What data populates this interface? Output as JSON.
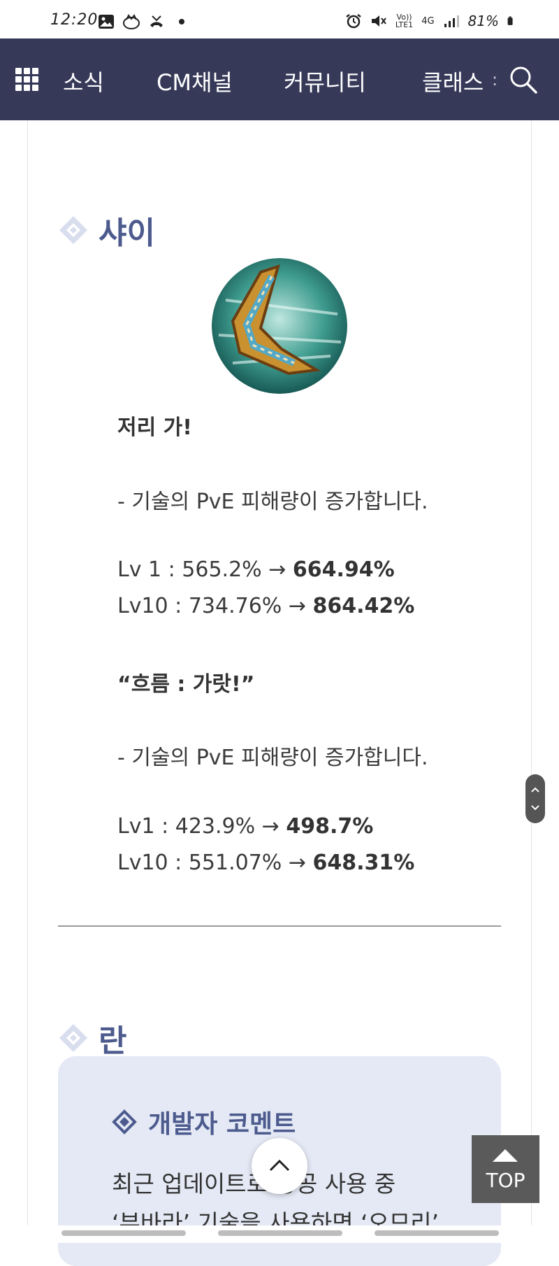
{
  "status_bar": {
    "time": "12:20",
    "battery": "81%",
    "network_top": "Vo))",
    "network_bottom": "LTE1",
    "signal_label": "4G"
  },
  "nav": {
    "items": [
      "소식",
      "CM채널",
      "커뮤니티",
      "클래스"
    ],
    "more": ":"
  },
  "section_shai": {
    "title": "샤이",
    "skill1": {
      "name": "저리 가!",
      "desc": "- 기술의 PvE 피해량이 증가합니다.",
      "lv1_label": "Lv 1 : 565.2% → ",
      "lv1_new": "664.94%",
      "lv10_label": "Lv10 : 734.76% → ",
      "lv10_new": "864.42%"
    },
    "skill2": {
      "name": "“흐름 : 가랏!”",
      "desc": "- 기술의 PvE 피해량이 증가합니다.",
      "lv1_label": "Lv1 : 423.9% → ",
      "lv1_new": "498.7%",
      "lv10_label": "Lv10 : 551.07% → ",
      "lv10_new": "648.31%"
    }
  },
  "section_ran": {
    "title": "란",
    "comment_title": "개발자 코멘트",
    "line1": "최근 업데이트로 방공 사용 중",
    "line2": "‘부바라’ 기술을 사용하면 ‘오므리’"
  },
  "buttons": {
    "top_label": "TOP"
  },
  "colors": {
    "nav_bg": "#363a58",
    "accent": "#4c5a8d",
    "comment_bg": "#e4e9f5"
  }
}
